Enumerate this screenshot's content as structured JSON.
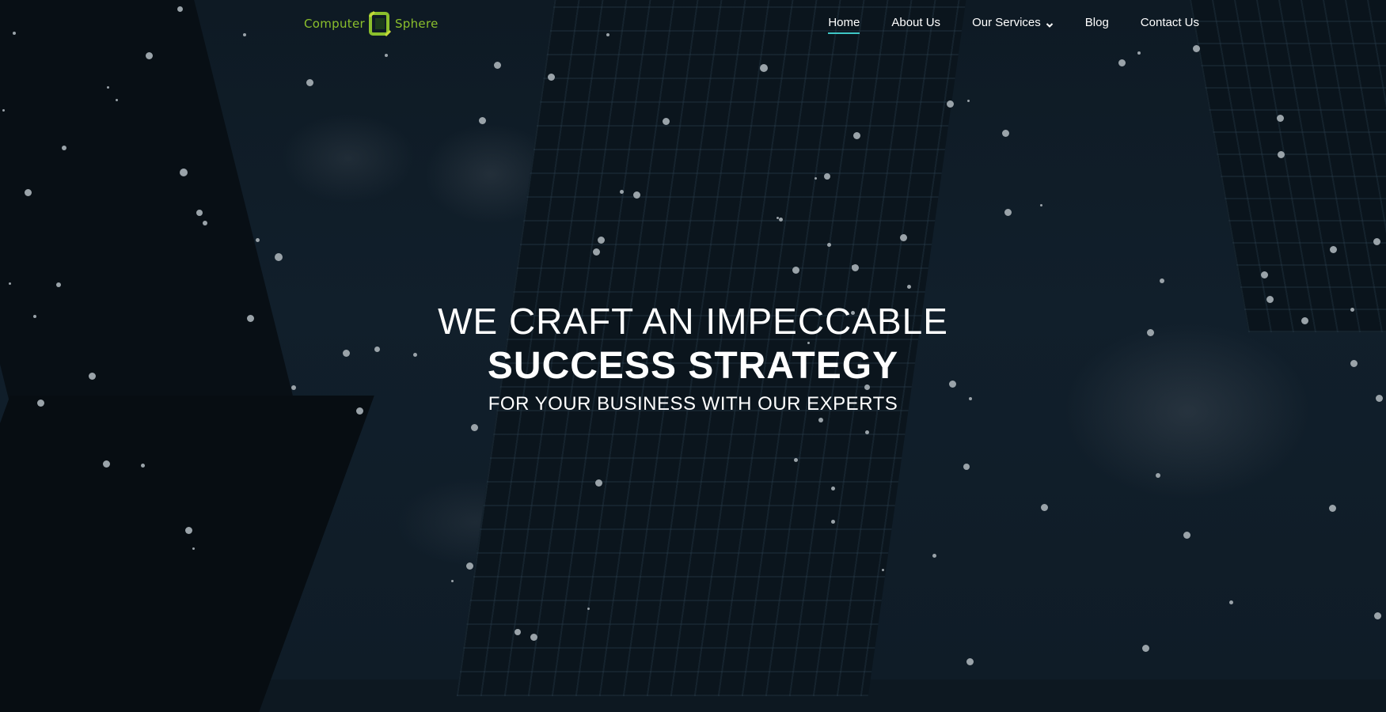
{
  "brand": {
    "logo_left": "Computer",
    "logo_right": "Sphere",
    "colors": {
      "logo_green": "#8bbf2c",
      "nav_active_underline": "#3fc7c7"
    }
  },
  "nav": {
    "items": [
      {
        "label": "Home",
        "active": true
      },
      {
        "label": "About Us",
        "active": false
      },
      {
        "label": "Our Services",
        "active": false,
        "has_dropdown": true,
        "icon": "chevron-down-icon"
      },
      {
        "label": "Blog",
        "active": false
      },
      {
        "label": "Contact Us",
        "active": false
      }
    ]
  },
  "hero": {
    "line1": "WE CRAFT AN IMPECCABLE",
    "line2": "SUCCESS STRATEGY",
    "line3": "FOR YOUR BUSINESS WITH OUR EXPERTS"
  }
}
